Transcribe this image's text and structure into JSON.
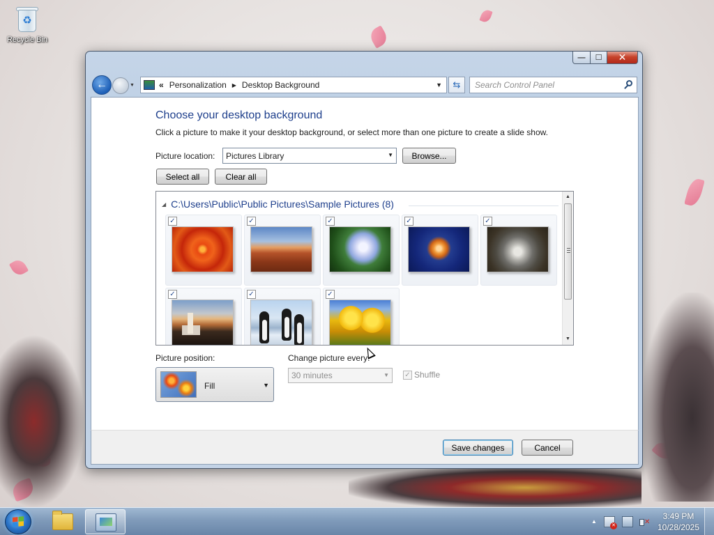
{
  "desktop": {
    "recycle_bin_label": "Recycle Bin"
  },
  "window": {
    "controls": {
      "minimize": "—",
      "maximize": "☐",
      "close": "✕"
    },
    "address": {
      "overflow": "«",
      "crumbs": [
        "Personalization",
        "Desktop Background"
      ],
      "separator": "▶",
      "dropdown": "▼"
    },
    "search": {
      "placeholder": "Search Control Panel"
    },
    "heading": "Choose your desktop background",
    "subheading": "Click a picture to make it your desktop background, or select more than one picture to create a slide show.",
    "picture_location": {
      "label": "Picture location:",
      "value": "Pictures Library",
      "browse": "Browse..."
    },
    "select_all": "Select all",
    "clear_all": "Clear all",
    "picture_group": {
      "path": "C:\\Users\\Public\\Public Pictures\\Sample Pictures (8)",
      "pictures": [
        {
          "name": "Chrysanthemum",
          "checked": true
        },
        {
          "name": "Desert",
          "checked": true
        },
        {
          "name": "Hydrangeas",
          "checked": true
        },
        {
          "name": "Jellyfish",
          "checked": true
        },
        {
          "name": "Koala",
          "checked": true
        },
        {
          "name": "Lighthouse",
          "checked": true
        },
        {
          "name": "Penguins",
          "checked": true
        },
        {
          "name": "Tulips",
          "checked": true
        }
      ]
    },
    "picture_position": {
      "label": "Picture position:",
      "value": "Fill"
    },
    "change_picture": {
      "label": "Change picture every:",
      "value": "30 minutes",
      "enabled": false
    },
    "shuffle": {
      "label": "Shuffle",
      "checked": true,
      "enabled": false
    },
    "save_changes": "Save changes",
    "cancel": "Cancel"
  },
  "taskbar": {
    "time": "3:49 PM",
    "date": "10/28/2025",
    "show_hidden_icons": "▲"
  },
  "colors": {
    "heading_blue": "#1e3f8c",
    "window_frame": "#c5d5e8",
    "close_red": "#c7432c"
  }
}
